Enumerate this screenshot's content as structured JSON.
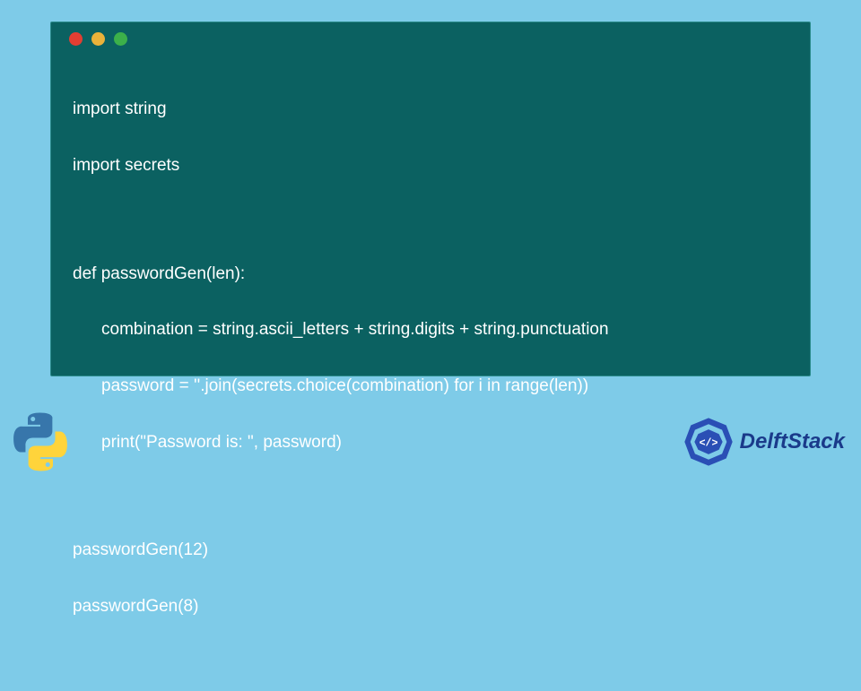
{
  "window": {
    "dots": {
      "red": "#e33e32",
      "yellow": "#eab23a",
      "green": "#3cb04a"
    },
    "background": "#0b6161"
  },
  "code": {
    "l1": "import string",
    "l2": "import secrets",
    "l3": "def passwordGen(len):",
    "l4": "combination = string.ascii_letters + string.digits + string.punctuation",
    "l5": "password = ''.join(secrets.choice(combination) for i in range(len))",
    "l6": "print(\"Password is: \", password)",
    "l7": "passwordGen(12)",
    "l8": "passwordGen(8)"
  },
  "brand": {
    "name": "DelftStack"
  }
}
